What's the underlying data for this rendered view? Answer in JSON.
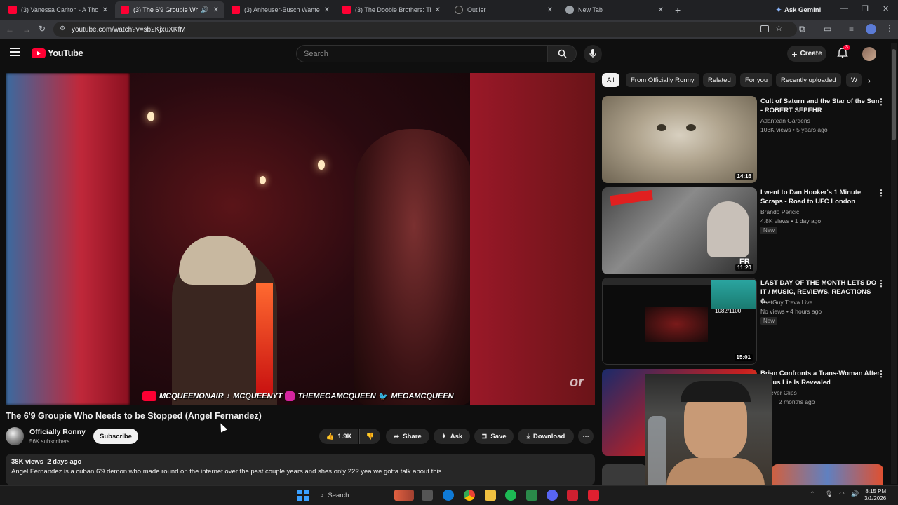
{
  "browser": {
    "tabs": [
      {
        "title": "(3) Vanessa Carlton - A Thousa",
        "favicon": "youtube-icon",
        "active": false
      },
      {
        "title": "(3) The 6'9 Groupie Who N",
        "favicon": "youtube-icon",
        "active": true
      },
      {
        "title": "(3) Anheuser-Busch Wanted A",
        "favicon": "youtube-icon",
        "active": false
      },
      {
        "title": "(3) The Doobie Brothers: Tiny D",
        "favicon": "youtube-icon",
        "active": false
      },
      {
        "title": "Outlier",
        "favicon": "outlier-icon",
        "active": false
      },
      {
        "title": "New Tab",
        "favicon": "chrome-icon",
        "active": false
      }
    ],
    "ask_gemini": "Ask Gemini",
    "url": "youtube.com/watch?v=sb2KjxuXKfM"
  },
  "youtube": {
    "logo_text": "YouTube",
    "search_placeholder": "Search",
    "create_label": "Create",
    "notification_count": "3"
  },
  "video": {
    "overlay_handles": [
      "MCQUEENONAIR",
      "MCQUEENYT",
      "THEMEGAMCQUEEN",
      "MEGAMCQUEEN"
    ],
    "title": "The 6'9 Groupie Who Needs to be Stopped (Angel Fernandez)",
    "channel": "Officially Ronny",
    "subscribers": "56K subscribers",
    "subscribe_label": "Subscribe",
    "likes": "1.9K",
    "share_label": "Share",
    "ask_label": "Ask",
    "save_label": "Save",
    "download_label": "Download",
    "views_date": "38K views  2 days ago",
    "description": "Angel Fernandez is a cuban 6'9 demon who made round on the internet over the past couple years and shes only 22? yea we gotta talk about this"
  },
  "chips": [
    "All",
    "From Officially Ronny",
    "Related",
    "For you",
    "Recently uploaded",
    "W"
  ],
  "recommendations": [
    {
      "title": "Cult of Saturn and the Star of the Sun - ROBERT SEPEHR",
      "channel": "Atlantean Gardens",
      "views": "103K views • 5 years ago",
      "duration": "14:16",
      "badge": ""
    },
    {
      "title": "I went to Dan Hooker's 1 Minute Scraps - Road to UFC London",
      "channel": "Brando Pericic",
      "views": "4.8K views • 1 day ago",
      "duration": "11:20",
      "badge": "New"
    },
    {
      "title": "LAST DAY OF THE MONTH LETS DO IT / MUSIC, REVIEWS, REACTIONS &...",
      "channel": "ThatGuy Treva Live",
      "views": "No views • 4 hours ago",
      "duration": "15:01",
      "badge": "New"
    },
    {
      "title": "Brian Confronts a Trans-Woman After erious Lie Is Revealed",
      "channel": "ever Clips",
      "views": "2 months ago",
      "duration": "",
      "badge": ""
    }
  ],
  "thumb_text": {
    "rec3_counter": "1082/1100",
    "rec2_caption": "FR"
  },
  "watermark": "or",
  "taskbar": {
    "search_label": "Search",
    "time": "8:15 PM",
    "date": "3/1/2026"
  },
  "colors": {
    "youtube_red": "#ff0033",
    "bg": "#0f0f0f",
    "chip_bg": "#272727"
  }
}
